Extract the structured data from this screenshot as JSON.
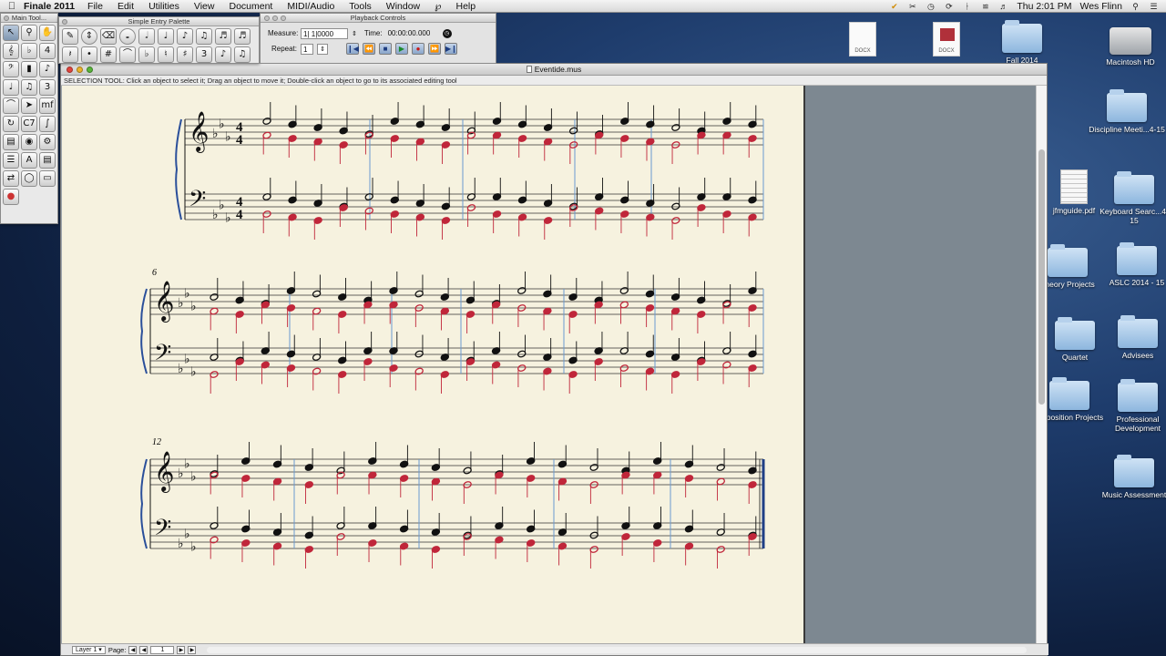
{
  "menubar": {
    "app_name": "Finale 2011",
    "menus": [
      "File",
      "Edit",
      "Utilities",
      "View",
      "Document",
      "MIDI/Audio",
      "Tools",
      "Window",
      "Help"
    ],
    "clock": "Thu 2:01 PM",
    "user": "Wes Flinn"
  },
  "main_tool_palette": {
    "title": "Main Tool..."
  },
  "simple_entry_palette": {
    "title": "Simple Entry Palette"
  },
  "playback": {
    "title": "Playback Controls",
    "measure_label": "Measure:",
    "measure_value": "1| 1|0000",
    "time_label": "Time:",
    "time_value": "00:00:00.000",
    "repeat_label": "Repeat:",
    "repeat_value": "1"
  },
  "document": {
    "title": "Eventide.mus",
    "status_text": "SELECTION TOOL: Click an object to select it; Drag an object to move it; Double-click an object to go to its associated editing tool",
    "layer": "Layer 1",
    "page_label": "Page:",
    "page_value": "1"
  },
  "score": {
    "system2_measure": "6",
    "system3_measure": "12"
  },
  "desktop": {
    "items": [
      {
        "label": "DOCX",
        "kind": "doc"
      },
      {
        "label": "DOCX",
        "kind": "docred"
      },
      {
        "label": "Fall 2014",
        "kind": "folder"
      },
      {
        "label": "Macintosh HD",
        "kind": "hd"
      },
      {
        "label": "Discipline Meeti...4-15",
        "kind": "folder"
      },
      {
        "label": "jfmguide.pdf",
        "kind": "pdf"
      },
      {
        "label": "Keyboard Searc...4-15",
        "kind": "folder"
      },
      {
        "label": "Theory Projects",
        "kind": "folder"
      },
      {
        "label": "ASLC 2014 - 15",
        "kind": "folder"
      },
      {
        "label": "Quartet",
        "kind": "folder"
      },
      {
        "label": "Advisees",
        "kind": "folder"
      },
      {
        "label": "omposition Projects",
        "kind": "folder"
      },
      {
        "label": "Professional Development",
        "kind": "folder"
      },
      {
        "label": "Music Assessment",
        "kind": "folder"
      }
    ]
  },
  "colors": {
    "voice2": "#c0263a",
    "barline": "#6a9ad0",
    "paper": "#f6f2df"
  }
}
